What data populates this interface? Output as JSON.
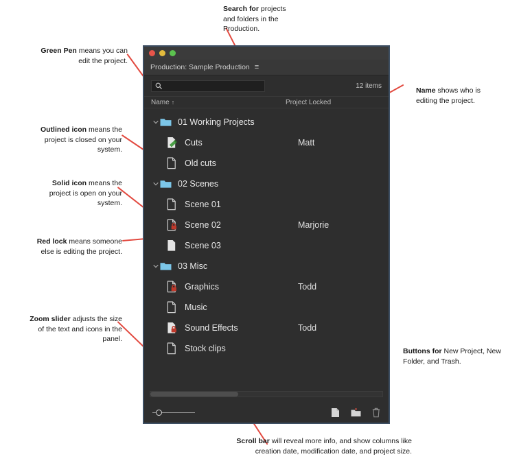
{
  "window": {
    "title_prefix": "Production:",
    "title": "Production: Sample Production",
    "menu_icon": "≡"
  },
  "search": {
    "value": "",
    "placeholder": "",
    "icon": "search-icon"
  },
  "status": {
    "item_count": "12 items"
  },
  "columns": {
    "name": "Name",
    "sort_arrow": "↑",
    "project_locked": "Project Locked"
  },
  "rows": [
    {
      "label": "01 Working Projects",
      "type": "folder",
      "depth": 0,
      "expanded": true,
      "owner": "",
      "locked": false,
      "pen": false
    },
    {
      "label": "Cuts",
      "type": "project-pen",
      "depth": 1,
      "expanded": false,
      "owner": "Matt",
      "locked": false,
      "pen": true
    },
    {
      "label": "Old cuts",
      "type": "project-outline",
      "depth": 1,
      "expanded": false,
      "owner": "",
      "locked": false,
      "pen": false
    },
    {
      "label": "02 Scenes",
      "type": "folder",
      "depth": 0,
      "expanded": true,
      "owner": "",
      "locked": false,
      "pen": false
    },
    {
      "label": "Scene 01",
      "type": "project-outline",
      "depth": 1,
      "expanded": false,
      "owner": "",
      "locked": false,
      "pen": false
    },
    {
      "label": "Scene 02",
      "type": "project-outline-lock",
      "depth": 1,
      "expanded": false,
      "owner": "Marjorie",
      "locked": true,
      "pen": false
    },
    {
      "label": "Scene 03",
      "type": "project-solid",
      "depth": 1,
      "expanded": false,
      "owner": "",
      "locked": false,
      "pen": false
    },
    {
      "label": "03 Misc",
      "type": "folder",
      "depth": 0,
      "expanded": true,
      "owner": "",
      "locked": false,
      "pen": false
    },
    {
      "label": "Graphics",
      "type": "project-outline-lock",
      "depth": 1,
      "expanded": false,
      "owner": "Todd",
      "locked": true,
      "pen": false
    },
    {
      "label": "Music",
      "type": "project-outline",
      "depth": 1,
      "expanded": false,
      "owner": "",
      "locked": false,
      "pen": false
    },
    {
      "label": "Sound Effects",
      "type": "project-solid-lock",
      "depth": 1,
      "expanded": false,
      "owner": "Todd",
      "locked": true,
      "pen": false
    },
    {
      "label": "Stock clips",
      "type": "project-outline",
      "depth": 1,
      "expanded": false,
      "owner": "",
      "locked": false,
      "pen": false
    }
  ],
  "bottom": {
    "zoom_slider_label": "zoom-slider",
    "new_project_icon": "new-project-icon",
    "new_folder_icon": "new-folder-icon",
    "trash_icon": "trash-icon"
  },
  "annotations": {
    "search": {
      "bold": "Search for",
      "rest": " projects and folders in the Production."
    },
    "green_pen": {
      "bold": "Green Pen",
      "rest": " means you can edit the project."
    },
    "outlined": {
      "bold": "Outlined icon",
      "rest": " means the project is closed on your system."
    },
    "solid": {
      "bold": "Solid icon",
      "rest": " means the project is open on your system."
    },
    "red_lock": {
      "bold": "Red lock",
      "rest": " means someone else is editing the project."
    },
    "zoom_slider": {
      "bold": "Zoom slider",
      "rest": " adjusts the size of the text and icons in the panel."
    },
    "name": {
      "bold": "Name",
      "rest": " shows who is editing the project."
    },
    "buttons": {
      "bold": "Buttons for",
      "rest": " New Project, New Folder, and Trash."
    },
    "scroll": {
      "bold": "Scroll bar",
      "rest": " will reveal more info, and show columns like creation date, modification date, and project size."
    }
  },
  "colors": {
    "accent_red": "#e2493f",
    "folder_blue": "#7cc6e8",
    "lock_red": "#c0392b",
    "pen_green": "#4a9e46",
    "window_border": "#3d4f63",
    "panel_bg": "#2e2e2e"
  }
}
